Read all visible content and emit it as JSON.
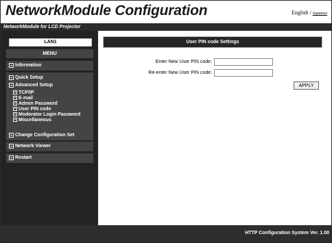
{
  "header": {
    "title": "NetworkModule Configuration",
    "lang_english": "English",
    "lang_sep": " / ",
    "lang_japanese": "Japanese",
    "subtitle": "NetworkModule for LCD Projector"
  },
  "sidebar": {
    "lan": "LAN1",
    "menu": "MENU",
    "information": "Information",
    "quick_setup": "Quick Setup",
    "advanced_setup": "Advanced Setup",
    "advanced_items": [
      "TCP/IP",
      "E-mail",
      "Admin Password",
      "User PIN code",
      "Moderator Login Password",
      "Miscellaneous"
    ],
    "change_config": "Change Configuration Set",
    "network_viewer": "Network Viewer",
    "restart": "Restart"
  },
  "main": {
    "section_title": "User PIN code Settings",
    "enter_label": "Enter New User PIN code:",
    "reenter_label": "Re-enter New User PIN code:",
    "enter_value": "",
    "reenter_value": "",
    "apply": "APPLY"
  },
  "footer": {
    "version": "HTTP Configuration System Ver. 1.00"
  }
}
